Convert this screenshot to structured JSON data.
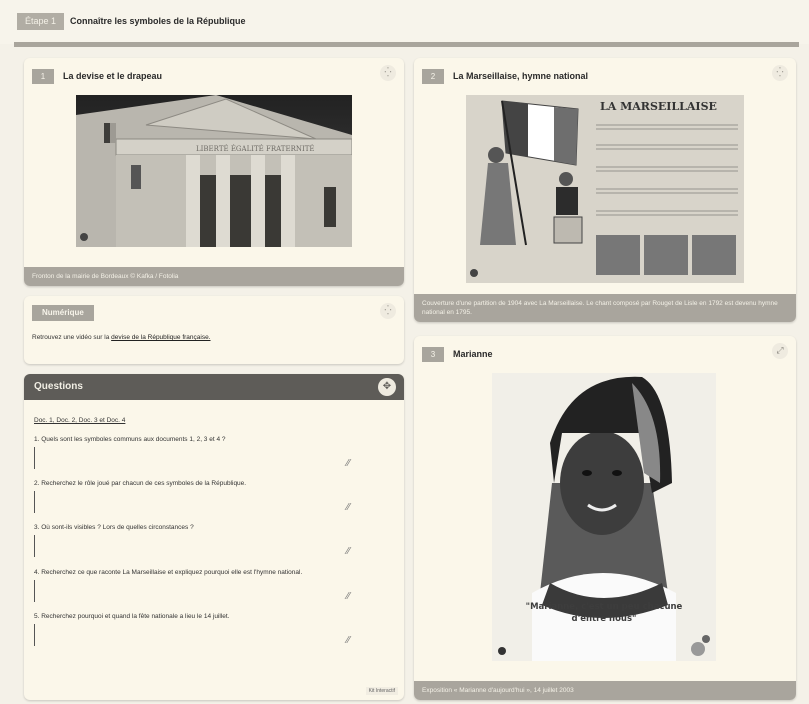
{
  "step": {
    "badge": "Étape 1",
    "title": "Connaître les symboles de la République"
  },
  "doc1": {
    "number": "1",
    "title": "La devise et le drapeau",
    "caption": "Fronton de la mairie de Bordeaux © Kafka / Fotolia",
    "engraving": "LIBERTÉ ÉGALITÉ FRATERNITÉ"
  },
  "doc2": {
    "number": "2",
    "title": "La Marseillaise, hymne national",
    "caption": "Couverture d'une partition de 1904 avec La Marseillaise. Le chant composé par Rouget de Lisle en 1792 est devenu hymne national en 1795.",
    "sheet_title": "LA MARSEILLAISE"
  },
  "doc3": {
    "number": "3",
    "title": "Marianne",
    "caption": "Exposition « Marianne d'aujourd'hui », 14 juillet 2003",
    "poster_quote": "\"Marianne, c'est un peu chacune d'entre nous\""
  },
  "numerique": {
    "label": "Numérique",
    "text": "Retrouvez une vidéo sur la",
    "link": "devise de la République française."
  },
  "questions": {
    "title": "Questions",
    "docs": "Doc. 1, Doc. 2, Doc. 3 et Doc. 4",
    "items": [
      "1. Quels sont les symboles communs aux documents 1, 2, 3 et 4 ?",
      "2. Recherchez le rôle joué par chacun de ces symboles de la République.",
      "3. Où sont-ils visibles ? Lors de quelles circonstances ?",
      "4. Recherchez ce que raconte La Marseillaise et expliquez pourquoi elle est l'hymne national.",
      "5. Recherchez pourquoi et quand la fête nationale a lieu le 14 juillet."
    ],
    "footer_tag": "Kit Interactif"
  },
  "icons": {
    "expand": "expand-icon",
    "fullscreen": "fullscreen-icon",
    "resize": "resize-handle-icon"
  }
}
